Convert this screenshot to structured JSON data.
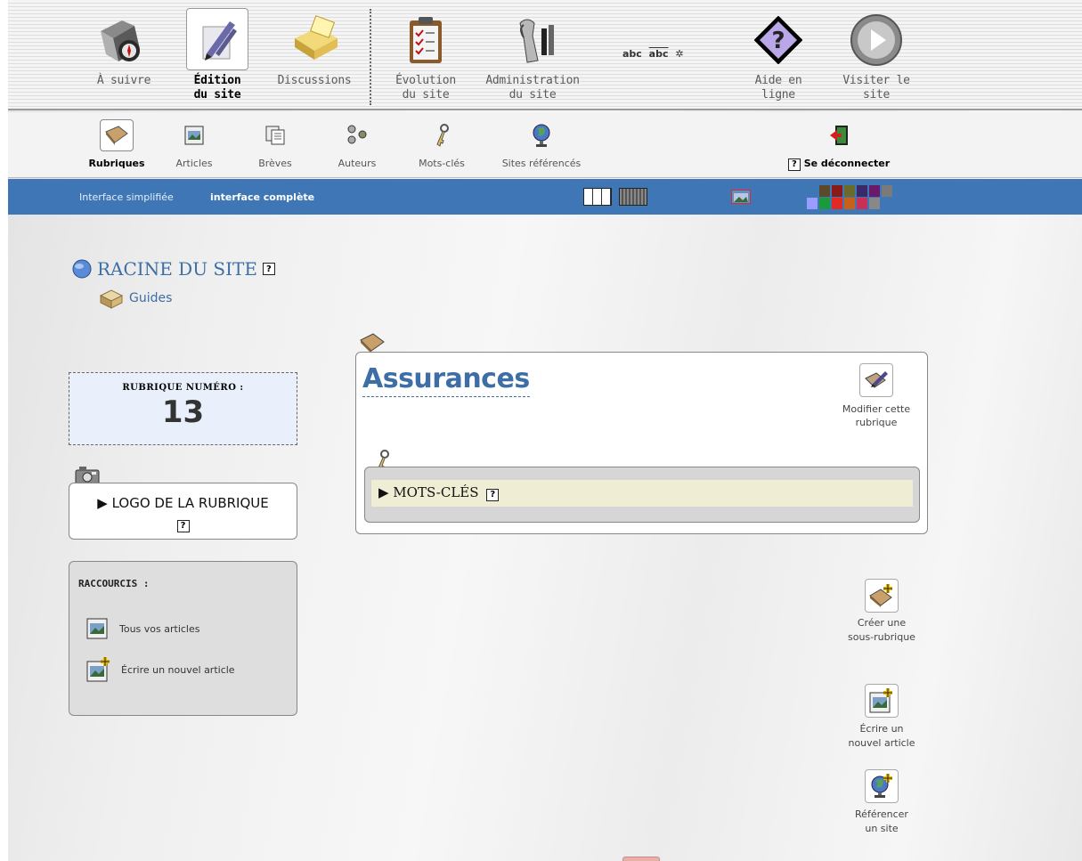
{
  "topnav": {
    "items": [
      {
        "label1": "À suivre",
        "label2": "",
        "icon": "compass-icon"
      },
      {
        "label1": "Édition",
        "label2": "du site",
        "icon": "pen-icon"
      },
      {
        "label1": "Discussions",
        "label2": "",
        "icon": "discussion-icon"
      },
      {
        "label1": "Évolution",
        "label2": "du site",
        "icon": "clipboard-icon"
      },
      {
        "label1": "Administration",
        "label2": "du site",
        "icon": "wrench-icon"
      },
      {
        "label1": "Aide en",
        "label2": "ligne",
        "icon": "help-icon"
      },
      {
        "label1": "Visiter le",
        "label2": "site",
        "icon": "play-icon"
      }
    ],
    "spell": "abc",
    "spell_sub": "abc"
  },
  "subnav": {
    "items": [
      {
        "label": "Rubriques",
        "icon": "section-icon"
      },
      {
        "label": "Articles",
        "icon": "article-icon"
      },
      {
        "label": "Brèves",
        "icon": "breve-icon"
      },
      {
        "label": "Auteurs",
        "icon": "authors-icon"
      },
      {
        "label": "Mots-clés",
        "icon": "key-icon"
      },
      {
        "label": "Sites référencés",
        "icon": "globe-icon"
      }
    ],
    "logout": "Se déconnecter",
    "help": "?"
  },
  "bluebar": {
    "simple": "Interface simplifiée",
    "complete": "interface complète",
    "swatch_colors": [
      "#9a9cff",
      "#1a9a3a",
      "#e02a22",
      "#c8601a",
      "#c8305a",
      "#888888",
      "#5a4a2a",
      "#8a1a1a",
      "#6a6a2a",
      "#3a2a6a",
      "#6a1a6a",
      "#7a7a7a"
    ]
  },
  "sidebar": {
    "root_label": "RACINE DU SITE",
    "child_label": "Guides",
    "number_title": "RUBRIQUE NUMÉRO :",
    "number": "13",
    "logo_title": "▶ LOGO DE LA RUBRIQUE",
    "shortcuts_title": "RACCOURCIS :",
    "shortcuts": [
      "Tous vos articles",
      "Écrire un nouvel article"
    ]
  },
  "main": {
    "title": "Assurances",
    "modify_label1": "Modifier cette",
    "modify_label2": "rubrique",
    "keywords_label": "▶ MOTS-CLÉS"
  },
  "actions": [
    {
      "line1": "Créer une",
      "line2": "sous-rubrique"
    },
    {
      "line1": "Écrire un",
      "line2": "nouvel article"
    },
    {
      "line1": "Référencer",
      "line2": "un site"
    }
  ],
  "help_char": "?"
}
